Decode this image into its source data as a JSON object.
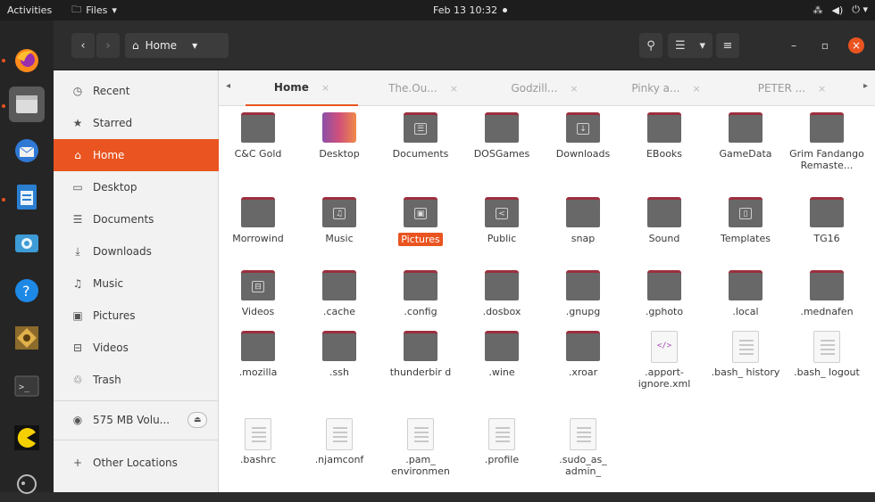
{
  "topbar": {
    "activities": "Activities",
    "app_menu": "Files",
    "clock": "Feb 13  10:32"
  },
  "headerbar": {
    "path_label": "Home"
  },
  "sidebar": {
    "items": [
      {
        "label": "Recent",
        "icon": "clock-icon"
      },
      {
        "label": "Starred",
        "icon": "star-icon"
      },
      {
        "label": "Home",
        "icon": "home-icon",
        "active": true
      },
      {
        "label": "Desktop",
        "icon": "desktop-icon"
      },
      {
        "label": "Documents",
        "icon": "document-icon"
      },
      {
        "label": "Downloads",
        "icon": "download-icon"
      },
      {
        "label": "Music",
        "icon": "music-icon"
      },
      {
        "label": "Pictures",
        "icon": "picture-icon"
      },
      {
        "label": "Videos",
        "icon": "video-icon"
      },
      {
        "label": "Trash",
        "icon": "trash-icon"
      }
    ],
    "volume_label": "575 MB Volu...",
    "other_locations": "Other Locations"
  },
  "tabs": [
    {
      "label": "Home",
      "active": true
    },
    {
      "label": "The.Ou..."
    },
    {
      "label": "Godzill..."
    },
    {
      "label": "Pinky a..."
    },
    {
      "label": "PETER ..."
    }
  ],
  "files": [
    {
      "name": "C&C Gold",
      "kind": "folder"
    },
    {
      "name": "Desktop",
      "kind": "desktop"
    },
    {
      "name": "Documents",
      "kind": "folder",
      "emblem": "☰"
    },
    {
      "name": "DOSGames",
      "kind": "folder"
    },
    {
      "name": "Downloads",
      "kind": "folder",
      "emblem": "↓"
    },
    {
      "name": "EBooks",
      "kind": "folder"
    },
    {
      "name": "GameData",
      "kind": "folder"
    },
    {
      "name": "Grim Fandango Remaste...",
      "kind": "folder"
    },
    {
      "name": "Morrowind",
      "kind": "folder"
    },
    {
      "name": "Music",
      "kind": "folder",
      "emblem": "♫"
    },
    {
      "name": "Pictures",
      "kind": "folder",
      "emblem": "▣",
      "selected": true
    },
    {
      "name": "Public",
      "kind": "folder",
      "emblem": "<"
    },
    {
      "name": "snap",
      "kind": "folder"
    },
    {
      "name": "Sound",
      "kind": "folder"
    },
    {
      "name": "Templates",
      "kind": "folder",
      "emblem": "▯"
    },
    {
      "name": "TG16",
      "kind": "folder"
    },
    {
      "name": "Videos",
      "kind": "folder",
      "emblem": "⊟"
    },
    {
      "name": ".cache",
      "kind": "folder"
    },
    {
      "name": ".config",
      "kind": "folder"
    },
    {
      "name": ".dosbox",
      "kind": "folder"
    },
    {
      "name": ".gnupg",
      "kind": "folder"
    },
    {
      "name": ".gphoto",
      "kind": "folder"
    },
    {
      "name": ".local",
      "kind": "folder"
    },
    {
      "name": ".mednafen",
      "kind": "folder"
    },
    {
      "name": ".mozilla",
      "kind": "folder"
    },
    {
      "name": ".ssh",
      "kind": "folder"
    },
    {
      "name": ".thunderbird",
      "kind": "folder",
      "display": "thunderbir d"
    },
    {
      "name": ".wine",
      "kind": "folder"
    },
    {
      "name": ".xroar",
      "kind": "folder"
    },
    {
      "name": ".apport-ignore.xml",
      "kind": "xml",
      "display": ".apport- ignore.xml"
    },
    {
      "name": ".bash_history",
      "kind": "text",
      "display": ".bash_ history"
    },
    {
      "name": ".bash_logout",
      "kind": "text",
      "display": ".bash_ logout"
    },
    {
      "name": ".bashrc",
      "kind": "text"
    },
    {
      "name": ".njamconf",
      "kind": "text"
    },
    {
      "name": ".pam_environment",
      "kind": "text",
      "display": ".pam_ environmen"
    },
    {
      "name": ".profile",
      "kind": "text"
    },
    {
      "name": ".sudo_as_admin_successful",
      "kind": "text",
      "display": ".sudo_as_ admin_"
    }
  ],
  "colors": {
    "accent": "#e95420",
    "folder_tab": "#9c2f3e",
    "folder_body": "#686868"
  }
}
